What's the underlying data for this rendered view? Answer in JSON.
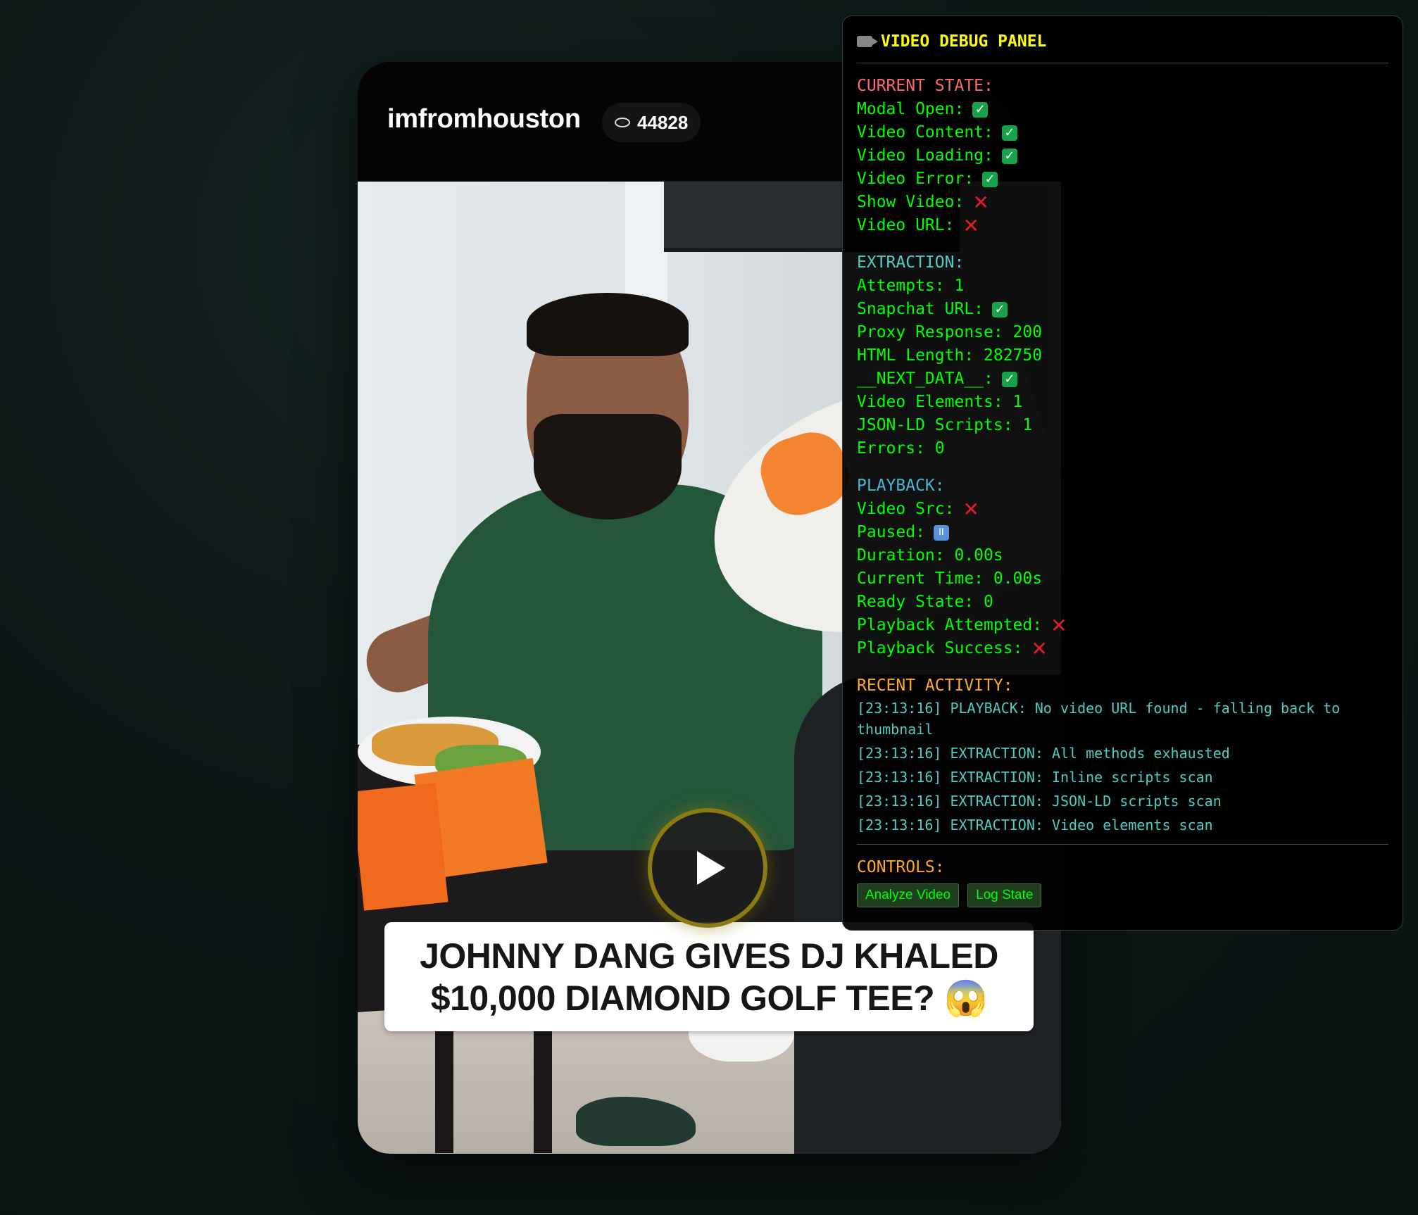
{
  "modal": {
    "username": "imfromhouston",
    "views": "44828",
    "close_glyph": "✕",
    "caption_line1": "JOHNNY DANG GIVES DJ KHALED",
    "caption_line2": "$10,000 DIAMOND GOLF TEE? 😱"
  },
  "debug": {
    "title": "VIDEO DEBUG PANEL",
    "current_state": {
      "heading": "CURRENT STATE:",
      "modal_open": "Modal Open:",
      "video_content": "Video Content:",
      "video_loading": "Video Loading:",
      "video_error": "Video Error:",
      "show_video": "Show Video:",
      "video_url": "Video URL:"
    },
    "extraction": {
      "heading": "EXTRACTION:",
      "attempts": "Attempts: 1",
      "snapchat_url": "Snapchat URL:",
      "proxy_response": "Proxy Response: 200",
      "html_length": "HTML Length: 282750",
      "next_data": "__NEXT_DATA__:",
      "video_elements": "Video Elements: 1",
      "jsonld_scripts": "JSON-LD Scripts: 1",
      "errors": "Errors: 0"
    },
    "playback": {
      "heading": "PLAYBACK:",
      "video_src": "Video Src:",
      "paused": "Paused:",
      "duration": "Duration: 0.00s",
      "current_time": "Current Time: 0.00s",
      "ready_state": "Ready State: 0",
      "playback_attempted": "Playback Attempted:",
      "playback_success": "Playback Success:"
    },
    "activity": {
      "heading": "RECENT ACTIVITY:",
      "logs": [
        "[23:13:16] PLAYBACK: No video URL found - falling back to thumbnail",
        "[23:13:16] EXTRACTION: All methods exhausted",
        "[23:13:16] EXTRACTION: Inline scripts scan",
        "[23:13:16] EXTRACTION: JSON-LD scripts scan",
        "[23:13:16] EXTRACTION: Video elements scan"
      ]
    },
    "controls": {
      "heading": "CONTROLS:",
      "analyze_label": "Analyze Video",
      "log_label": "Log State"
    },
    "glyphs": {
      "check": "✓",
      "cross": "✕",
      "pause": "II"
    },
    "colors": {
      "text": "#00ff00",
      "title": "#ffff00",
      "current_state": "#ff6b6b",
      "extraction": "#4ecdc4",
      "playback": "#45b7d1",
      "activity": "#ffa726"
    }
  }
}
